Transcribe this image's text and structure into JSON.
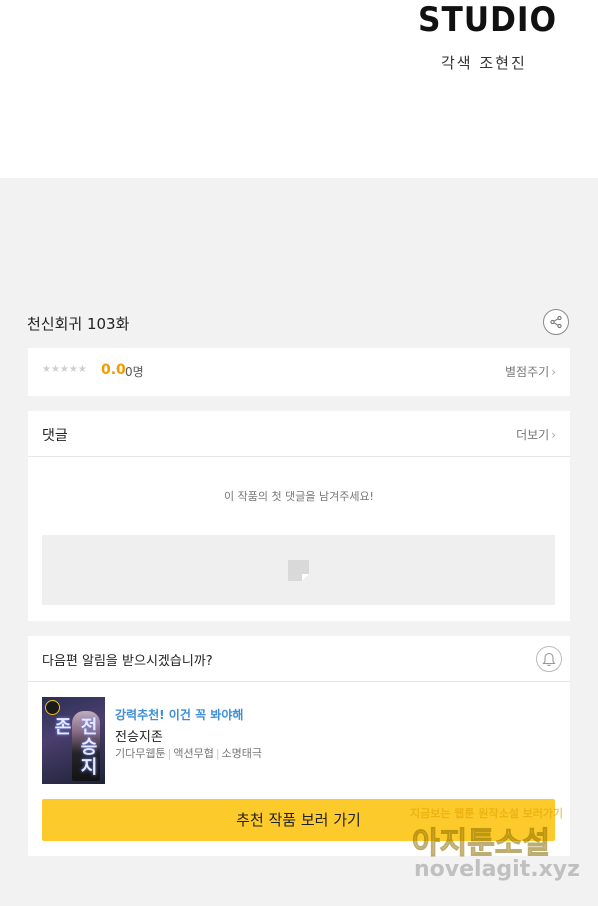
{
  "header": {
    "logo_text": "STUDIO",
    "credit": "각색 조현진"
  },
  "episode": {
    "title": "천신회귀 103화",
    "share_icon": "share-icon"
  },
  "rating": {
    "stars": "★★★★★",
    "score": "0.0",
    "count": "0명",
    "rate_label": "별점주기",
    "chevron": "›"
  },
  "comments": {
    "title": "댓글",
    "more_label": "더보기",
    "chevron": "›",
    "empty_message": "이 작품의 첫 댓글을 남겨주세요!",
    "placeholder_icon": "image-placeholder-icon"
  },
  "next_episode": {
    "question": "다음편 알림을 받으시겠습니까?",
    "bell_icon": "bell-icon",
    "recommendation": {
      "thumb_text": "전승지존",
      "promo_tag": "강력추천! 이건 꼭 봐야해",
      "title": "전승지존",
      "genres": [
        "기다무웹툰",
        "액션무협",
        "소명태극"
      ]
    },
    "cta_label": "추천 작품 보러 가기"
  },
  "watermark": {
    "line1": "지금보는 웹툰 원작소설 보러가기",
    "line2": "아지툰소설",
    "line3": "novelagit.xyz"
  },
  "colors": {
    "accent_yellow": "#fccb2b",
    "score_orange": "#f29b00",
    "promo_blue": "#3d8ed9",
    "page_bg": "#f2f2f2"
  }
}
